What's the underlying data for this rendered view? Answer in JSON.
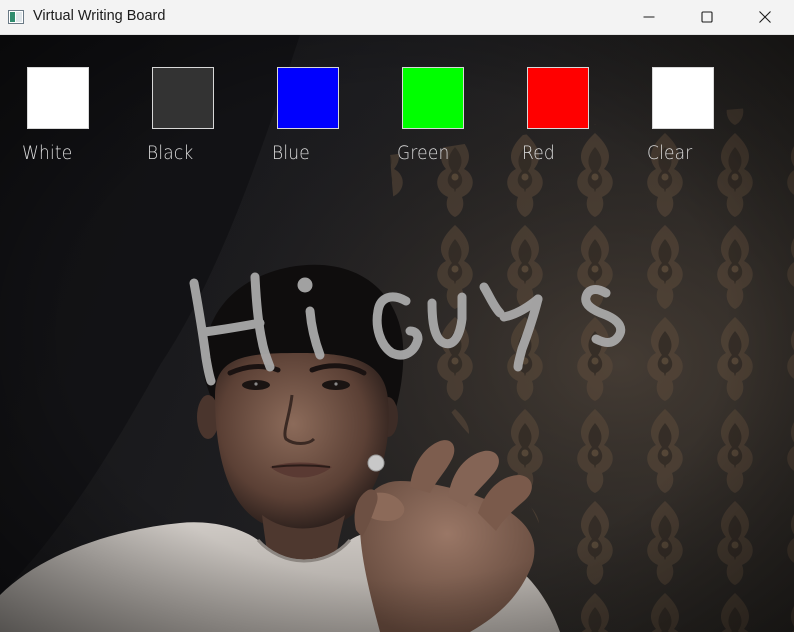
{
  "window": {
    "title": "Virtual Writing Board",
    "icon": "app-window-icon",
    "controls": {
      "minimize_icon": "minimize-icon",
      "maximize_icon": "maximize-icon",
      "close_icon": "close-icon"
    }
  },
  "palette": [
    {
      "label": "White",
      "color": "#ffffff"
    },
    {
      "label": "Black",
      "color": "#333333"
    },
    {
      "label": "Blue",
      "color": "#0000ff"
    },
    {
      "label": "Green",
      "color": "#00ff00"
    },
    {
      "label": "Red",
      "color": "#ff0000"
    },
    {
      "label": "Clear",
      "color": "#ffffff"
    }
  ],
  "drawing": {
    "handwritten_text": "Hi Guys",
    "stroke_color": "#a9a9a9"
  },
  "cursor": {
    "icon": "fingertip-pointer-icon",
    "color": "#c8c8c8"
  }
}
